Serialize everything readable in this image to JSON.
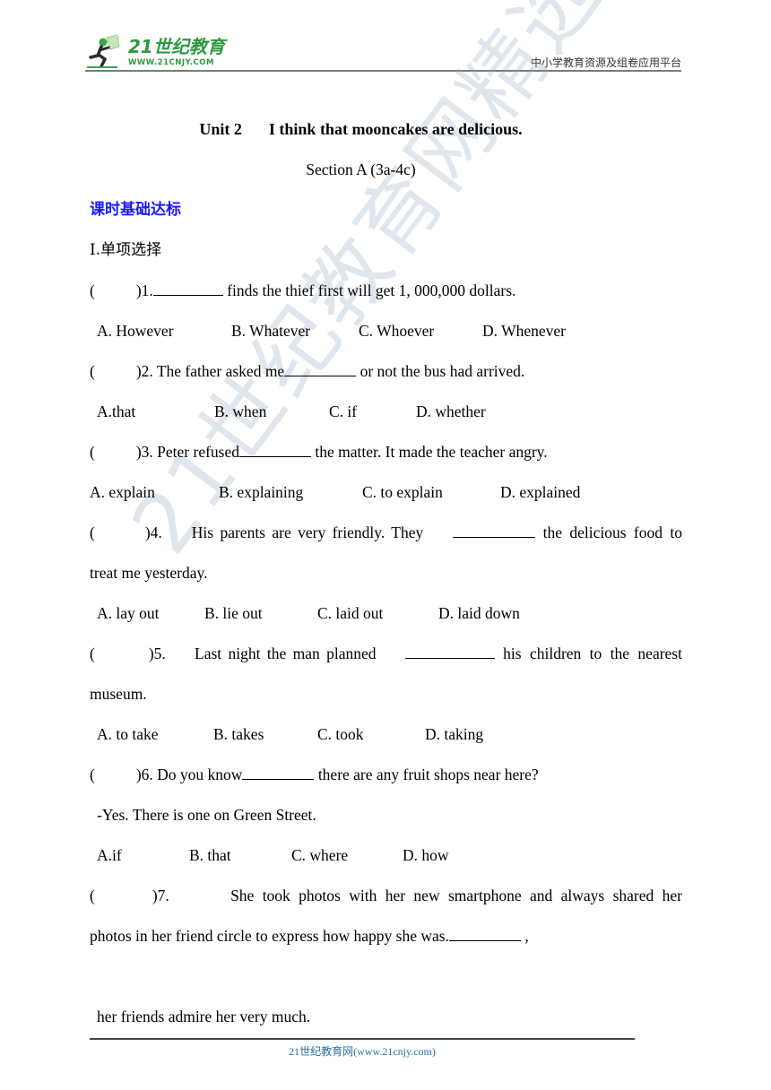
{
  "header": {
    "logo_text": "21世纪教育",
    "logo_url": "WWW.21CNJY.COM",
    "platform_name": "中小学教育资源及组卷应用平台"
  },
  "document": {
    "title_unit": "Unit 2",
    "title_text": "I think that mooncakes are delicious.",
    "subtitle": "Section A (3a-4c)",
    "section_heading": "课时基础达标",
    "part_heading": "I.单项选择"
  },
  "questions": [
    {
      "open_paren": "(",
      "num": ")1.",
      "before_blank": "",
      "after_blank": " finds the thief first will get 1, 000,000 dollars.",
      "options": [
        "A. However",
        "B. Whatever",
        "C. Whoever",
        "D. Whenever"
      ]
    },
    {
      "open_paren": "(",
      "num": ")2.",
      "before_blank": " The father asked me",
      "after_blank": " or not the bus had arrived.",
      "options": [
        "A.that",
        "B. when",
        "C. if",
        "D. whether"
      ]
    },
    {
      "open_paren": "(",
      "num": ")3.",
      "before_blank": " Peter refused",
      "after_blank": " the matter. It made the teacher angry.",
      "options": [
        "A. explain",
        "B. explaining",
        "C. to explain",
        "D. explained"
      ]
    },
    {
      "open_paren": "(",
      "num": ")4.",
      "before_blank": " His parents are very friendly. They",
      "after_blank": " the delicious food to",
      "continuation": "treat me yesterday.",
      "options": [
        "A. lay out",
        "B. lie out",
        "C. laid out",
        "D. laid down"
      ]
    },
    {
      "open_paren": "(",
      "num": ")5.",
      "before_blank": " Last night the man planned",
      "after_blank": " his children to the nearest",
      "continuation": "museum.",
      "options": [
        "A. to take",
        "B. takes",
        "C. took",
        "D. taking"
      ]
    },
    {
      "open_paren": "(",
      "num": ")6.",
      "before_blank": " Do you know",
      "after_blank": " there are any fruit shops near here?",
      "reply": "-Yes. There is one on Green Street.",
      "options": [
        "A.if",
        "B. that",
        "C. where",
        "D. how"
      ]
    },
    {
      "open_paren": "(",
      "num": ")7.",
      "first_line": " She took photos with her new smartphone and always shared her",
      "second_line_before_blank": "photos in her friend circle to express how happy she was.",
      "second_line_after_blank": " ,",
      "third_line": "her friends admire her very much."
    }
  ],
  "footer": {
    "text": "21世纪教育网(www.21cnjy.com)"
  },
  "watermark": {
    "text": "21世纪教育网精选资料"
  }
}
